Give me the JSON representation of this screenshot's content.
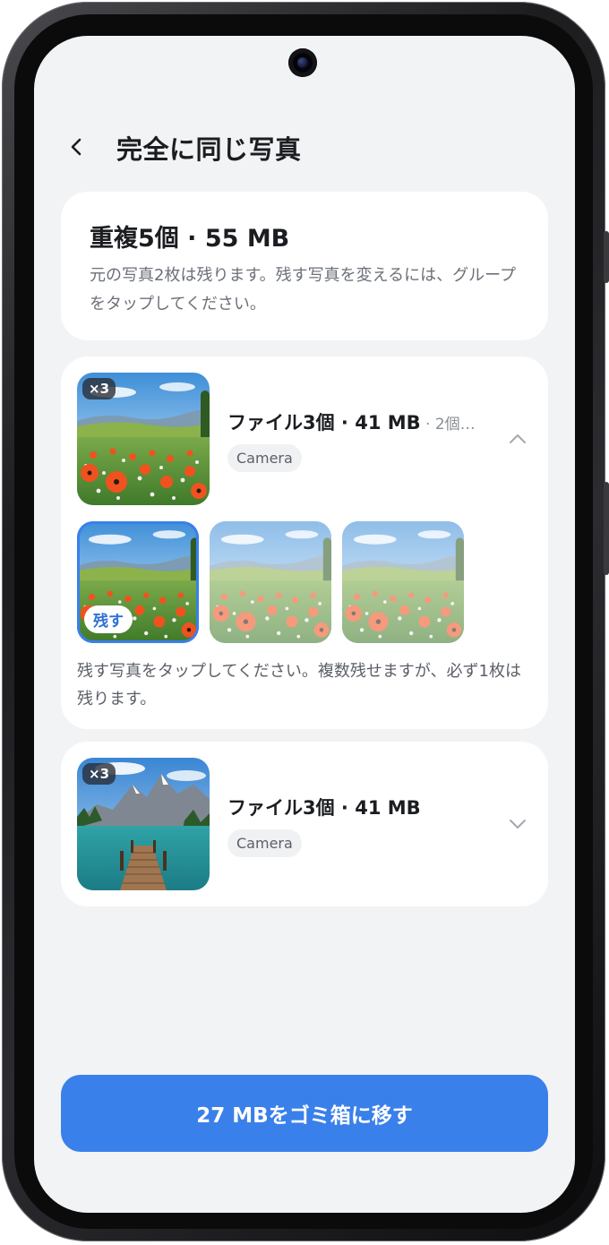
{
  "header": {
    "title": "完全に同じ写真",
    "back_icon": "chevron-left-icon"
  },
  "summary": {
    "title": "重複5個 · 55 MB",
    "description": "元の写真2枚は残ります。残す写真を変えるには、グループをタップしてください。"
  },
  "groups": [
    {
      "count_badge": "×3",
      "title": "ファイル3個 · 41 MB",
      "subtitle": " · 2個…",
      "chip": "Camera",
      "expanded": true,
      "chevron_icon": "chevron-up-icon",
      "keep_label": "残す",
      "hint": "残す写真をタップしてください。複数残せますが、必ず1枚は残ります。",
      "photo_type": "poppy-field"
    },
    {
      "count_badge": "×3",
      "title": "ファイル3個 · 41 MB",
      "chip": "Camera",
      "expanded": false,
      "chevron_icon": "chevron-down-icon",
      "photo_type": "mountain-lake-pier"
    }
  ],
  "footer": {
    "trash_button_label": "27 MBをゴミ箱に移す"
  },
  "colors": {
    "accent": "#3a80ea",
    "background": "#f2f3f5",
    "card": "#ffffff"
  }
}
